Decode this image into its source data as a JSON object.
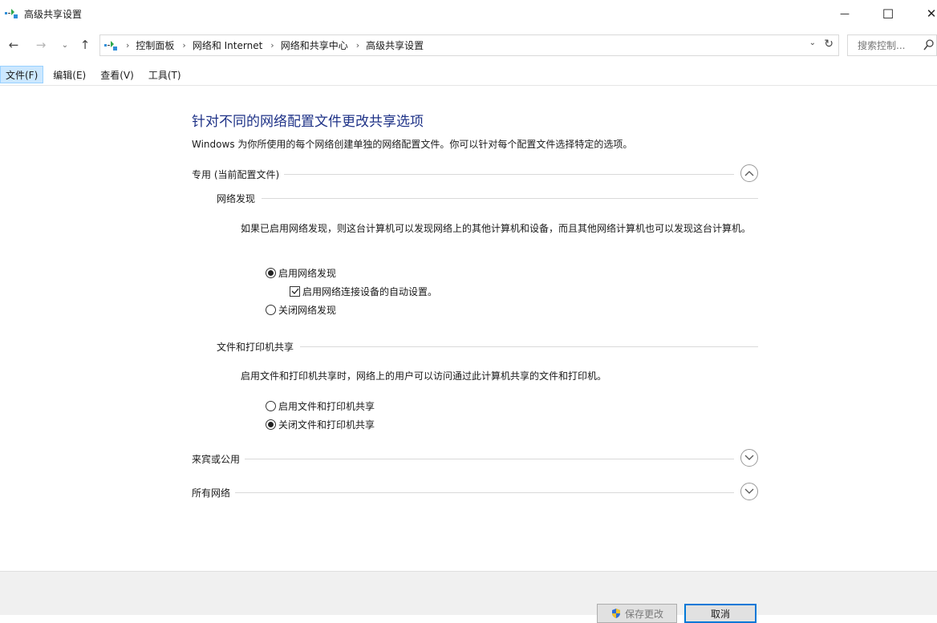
{
  "window": {
    "title": "高级共享设置",
    "minimize_glyph": "—",
    "maximize_glyph": "☐",
    "close_glyph": "✕"
  },
  "address_bar": {
    "crumbs": [
      "控制面板",
      "网络和 Internet",
      "网络和共享中心",
      "高级共享设置"
    ],
    "separator": "›"
  },
  "search": {
    "placeholder": "搜索控制..."
  },
  "menu": {
    "items": [
      {
        "label": "文件(F)"
      },
      {
        "label": "编辑(E)"
      },
      {
        "label": "查看(V)"
      },
      {
        "label": "工具(T)"
      }
    ]
  },
  "main": {
    "title": "针对不同的网络配置文件更改共享选项",
    "description": "Windows 为你所使用的每个网络创建单独的网络配置文件。你可以针对每个配置文件选择特定的选项。",
    "private_profile": {
      "label": "专用 (当前配置文件)",
      "expanded": true,
      "network_discovery": {
        "label": "网络发现",
        "description": "如果已启用网络发现，则这台计算机可以发现网络上的其他计算机和设备，而且其他网络计算机也可以发现这台计算机。",
        "option_on": "启用网络发现",
        "option_auto": "启用网络连接设备的自动设置。",
        "option_off": "关闭网络发现",
        "selected": "on",
        "auto_setup_checked": true
      },
      "file_printer_sharing": {
        "label": "文件和打印机共享",
        "description": "启用文件和打印机共享时，网络上的用户可以访问通过此计算机共享的文件和打印机。",
        "option_on": "启用文件和打印机共享",
        "option_off": "关闭文件和打印机共享",
        "selected": "off"
      }
    },
    "guest_profile": {
      "label": "来宾或公用",
      "expanded": false
    },
    "all_networks": {
      "label": "所有网络",
      "expanded": false
    }
  },
  "footer": {
    "save_label": "保存更改",
    "cancel_label": "取消"
  },
  "colors": {
    "title_blue": "#1e3287",
    "menu_highlight": "#cce8ff",
    "accent": "#0078d7"
  }
}
